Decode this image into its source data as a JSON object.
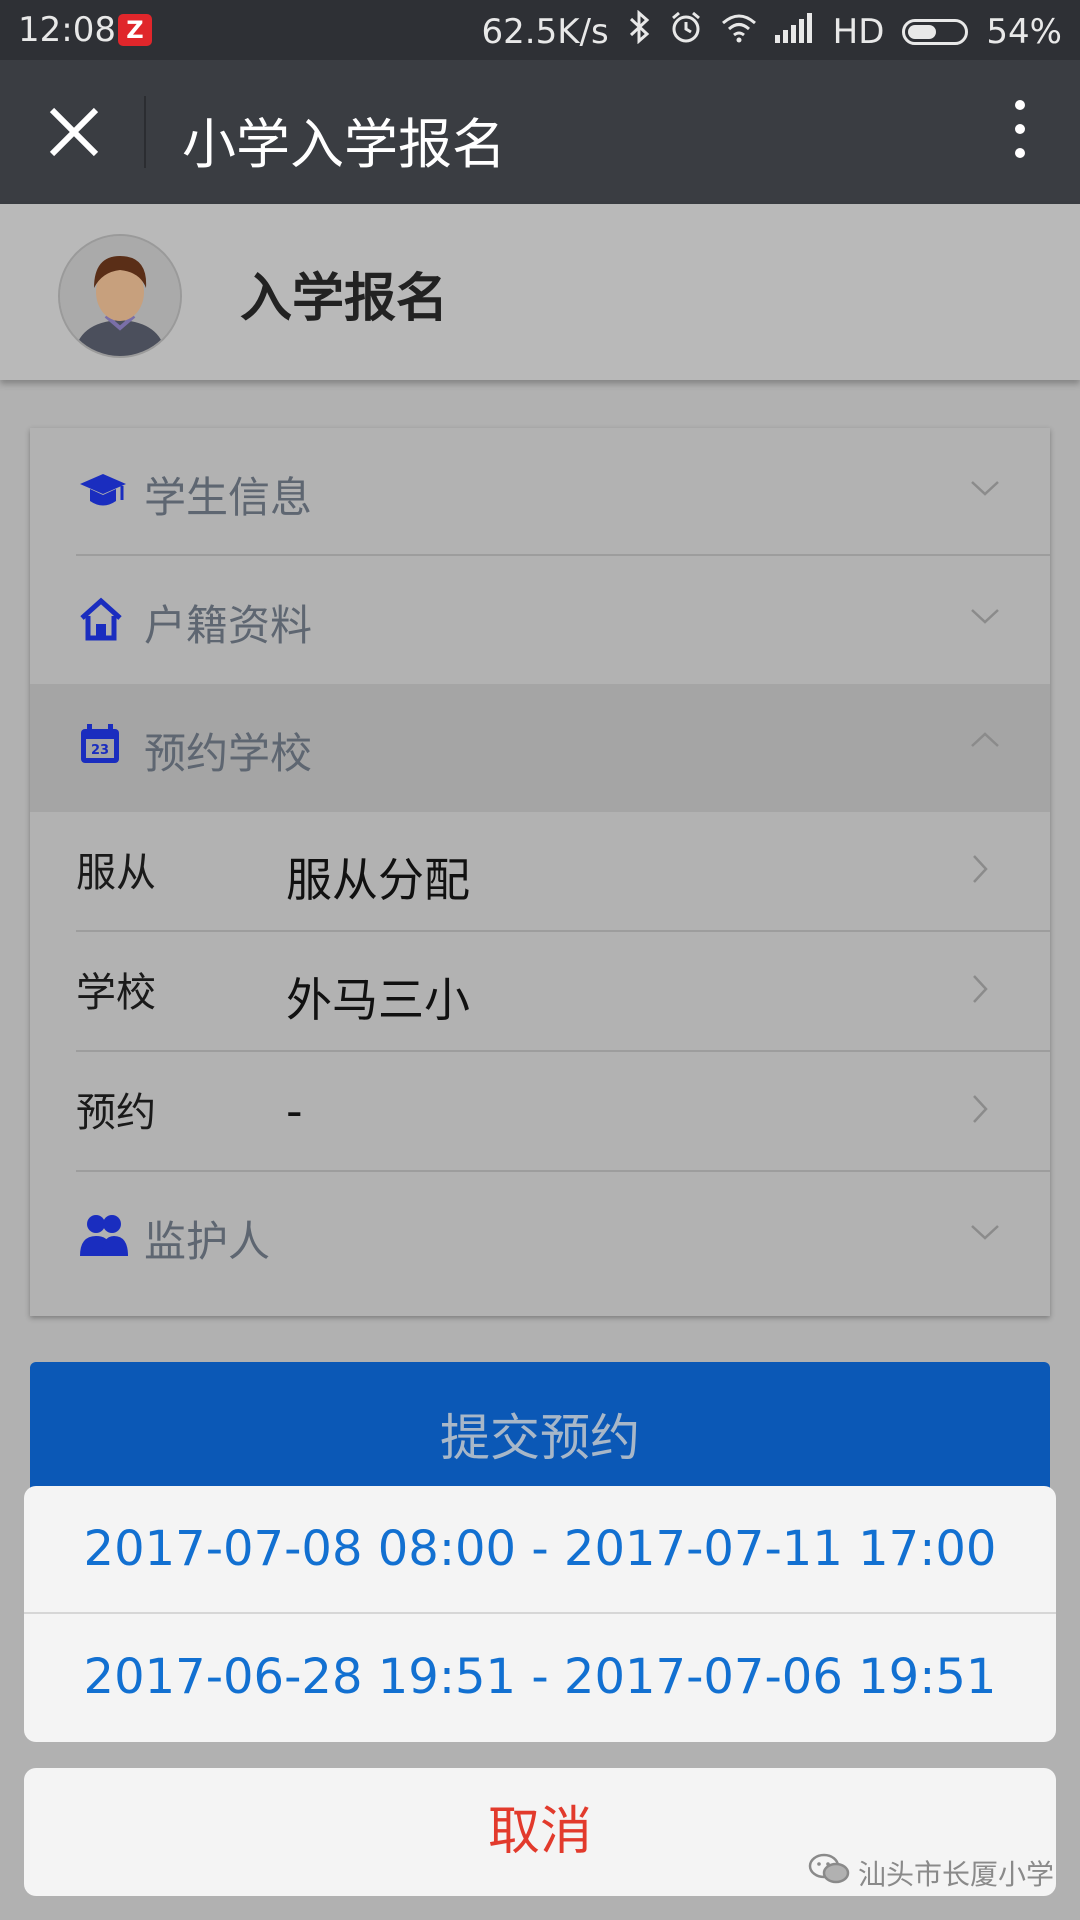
{
  "status_bar": {
    "time": "12:08",
    "app_badge": "Z",
    "net_speed": "62.5K/s",
    "network_type": "HD",
    "battery": "54%",
    "battery_level": 0.54,
    "icons": [
      "bluetooth-icon",
      "alarm-icon",
      "wifi-icon",
      "signal-icon",
      "battery-icon"
    ]
  },
  "title_bar": {
    "title": "小学入学报名",
    "close_icon": "close-icon",
    "more_icon": "more-vertical-icon"
  },
  "header": {
    "title": "入学报名",
    "avatar_icon": "user-avatar"
  },
  "sections": {
    "student": {
      "label": "学生信息",
      "icon": "graduation-cap-icon",
      "state": "collapsed"
    },
    "household": {
      "label": "户籍资料",
      "icon": "home-icon",
      "state": "collapsed"
    },
    "school": {
      "label": "预约学校",
      "icon": "calendar-icon",
      "state": "expanded",
      "calendar_day": "23",
      "fields": [
        {
          "label": "服从",
          "value": "服从分配"
        },
        {
          "label": "学校",
          "value": "外马三小"
        },
        {
          "label": "预约",
          "value": "-"
        }
      ]
    },
    "guardian": {
      "label": "监护人",
      "icon": "users-icon",
      "state": "collapsed"
    }
  },
  "submit_button": {
    "label": "提交预约"
  },
  "action_sheet": {
    "options": [
      "2017-07-08 08:00 - 2017-07-11 17:00",
      "2017-06-28 19:51 - 2017-07-06 19:51"
    ],
    "cancel": "取消"
  },
  "watermark": {
    "text": "汕头市长厦小学",
    "icon": "wechat-icon"
  },
  "colors": {
    "titlebar": "#3a3d42",
    "accent_blue": "#0b58b6",
    "option_text": "#1270d1",
    "cancel_text": "#e23a2c",
    "icon_blue": "#1a2dbf"
  }
}
